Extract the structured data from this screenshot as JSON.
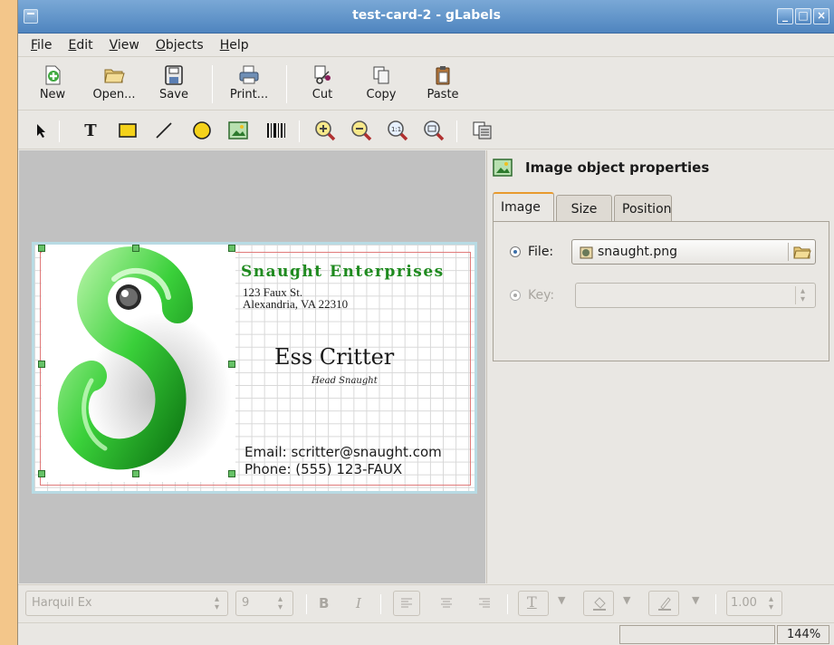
{
  "window": {
    "title": "test-card-2 - gLabels",
    "buttons": [
      "_",
      "□",
      "×"
    ]
  },
  "menubar": [
    "File",
    "Edit",
    "View",
    "Objects",
    "Help"
  ],
  "toolbar": {
    "new": "New",
    "open": "Open...",
    "save": "Save",
    "print": "Print...",
    "cut": "Cut",
    "copy": "Copy",
    "paste": "Paste"
  },
  "drawing_tools": [
    "select-arrow-icon",
    "text-tool-icon",
    "box-tool-icon",
    "line-tool-icon",
    "ellipse-tool-icon",
    "image-tool-icon",
    "barcode-tool-icon",
    "zoom-in-icon",
    "zoom-out-icon",
    "zoom-1to1-icon",
    "zoom-fit-icon",
    "merge-properties-icon"
  ],
  "card": {
    "company": "Snaught Enterprises",
    "street": "123 Faux St.",
    "city": "Alexandria, VA 22310",
    "name": "Ess Critter",
    "job_title": "Head Snaught",
    "email": "Email: scritter@snaught.com",
    "phone": "Phone: (555) 123-FAUX",
    "company_color": "#1f8a1f"
  },
  "properties": {
    "header": "Image object properties",
    "tabs": [
      "Image",
      "Size",
      "Position"
    ],
    "active_tab": "Image",
    "file_label": "File:",
    "file_value": "snaught.png",
    "key_label": "Key:",
    "key_value": ""
  },
  "format_bar": {
    "font": "Harquil Ex",
    "size": "9",
    "bold": "B",
    "italic": "I",
    "line_width": "1.00"
  },
  "status": {
    "zoom": "144%"
  }
}
